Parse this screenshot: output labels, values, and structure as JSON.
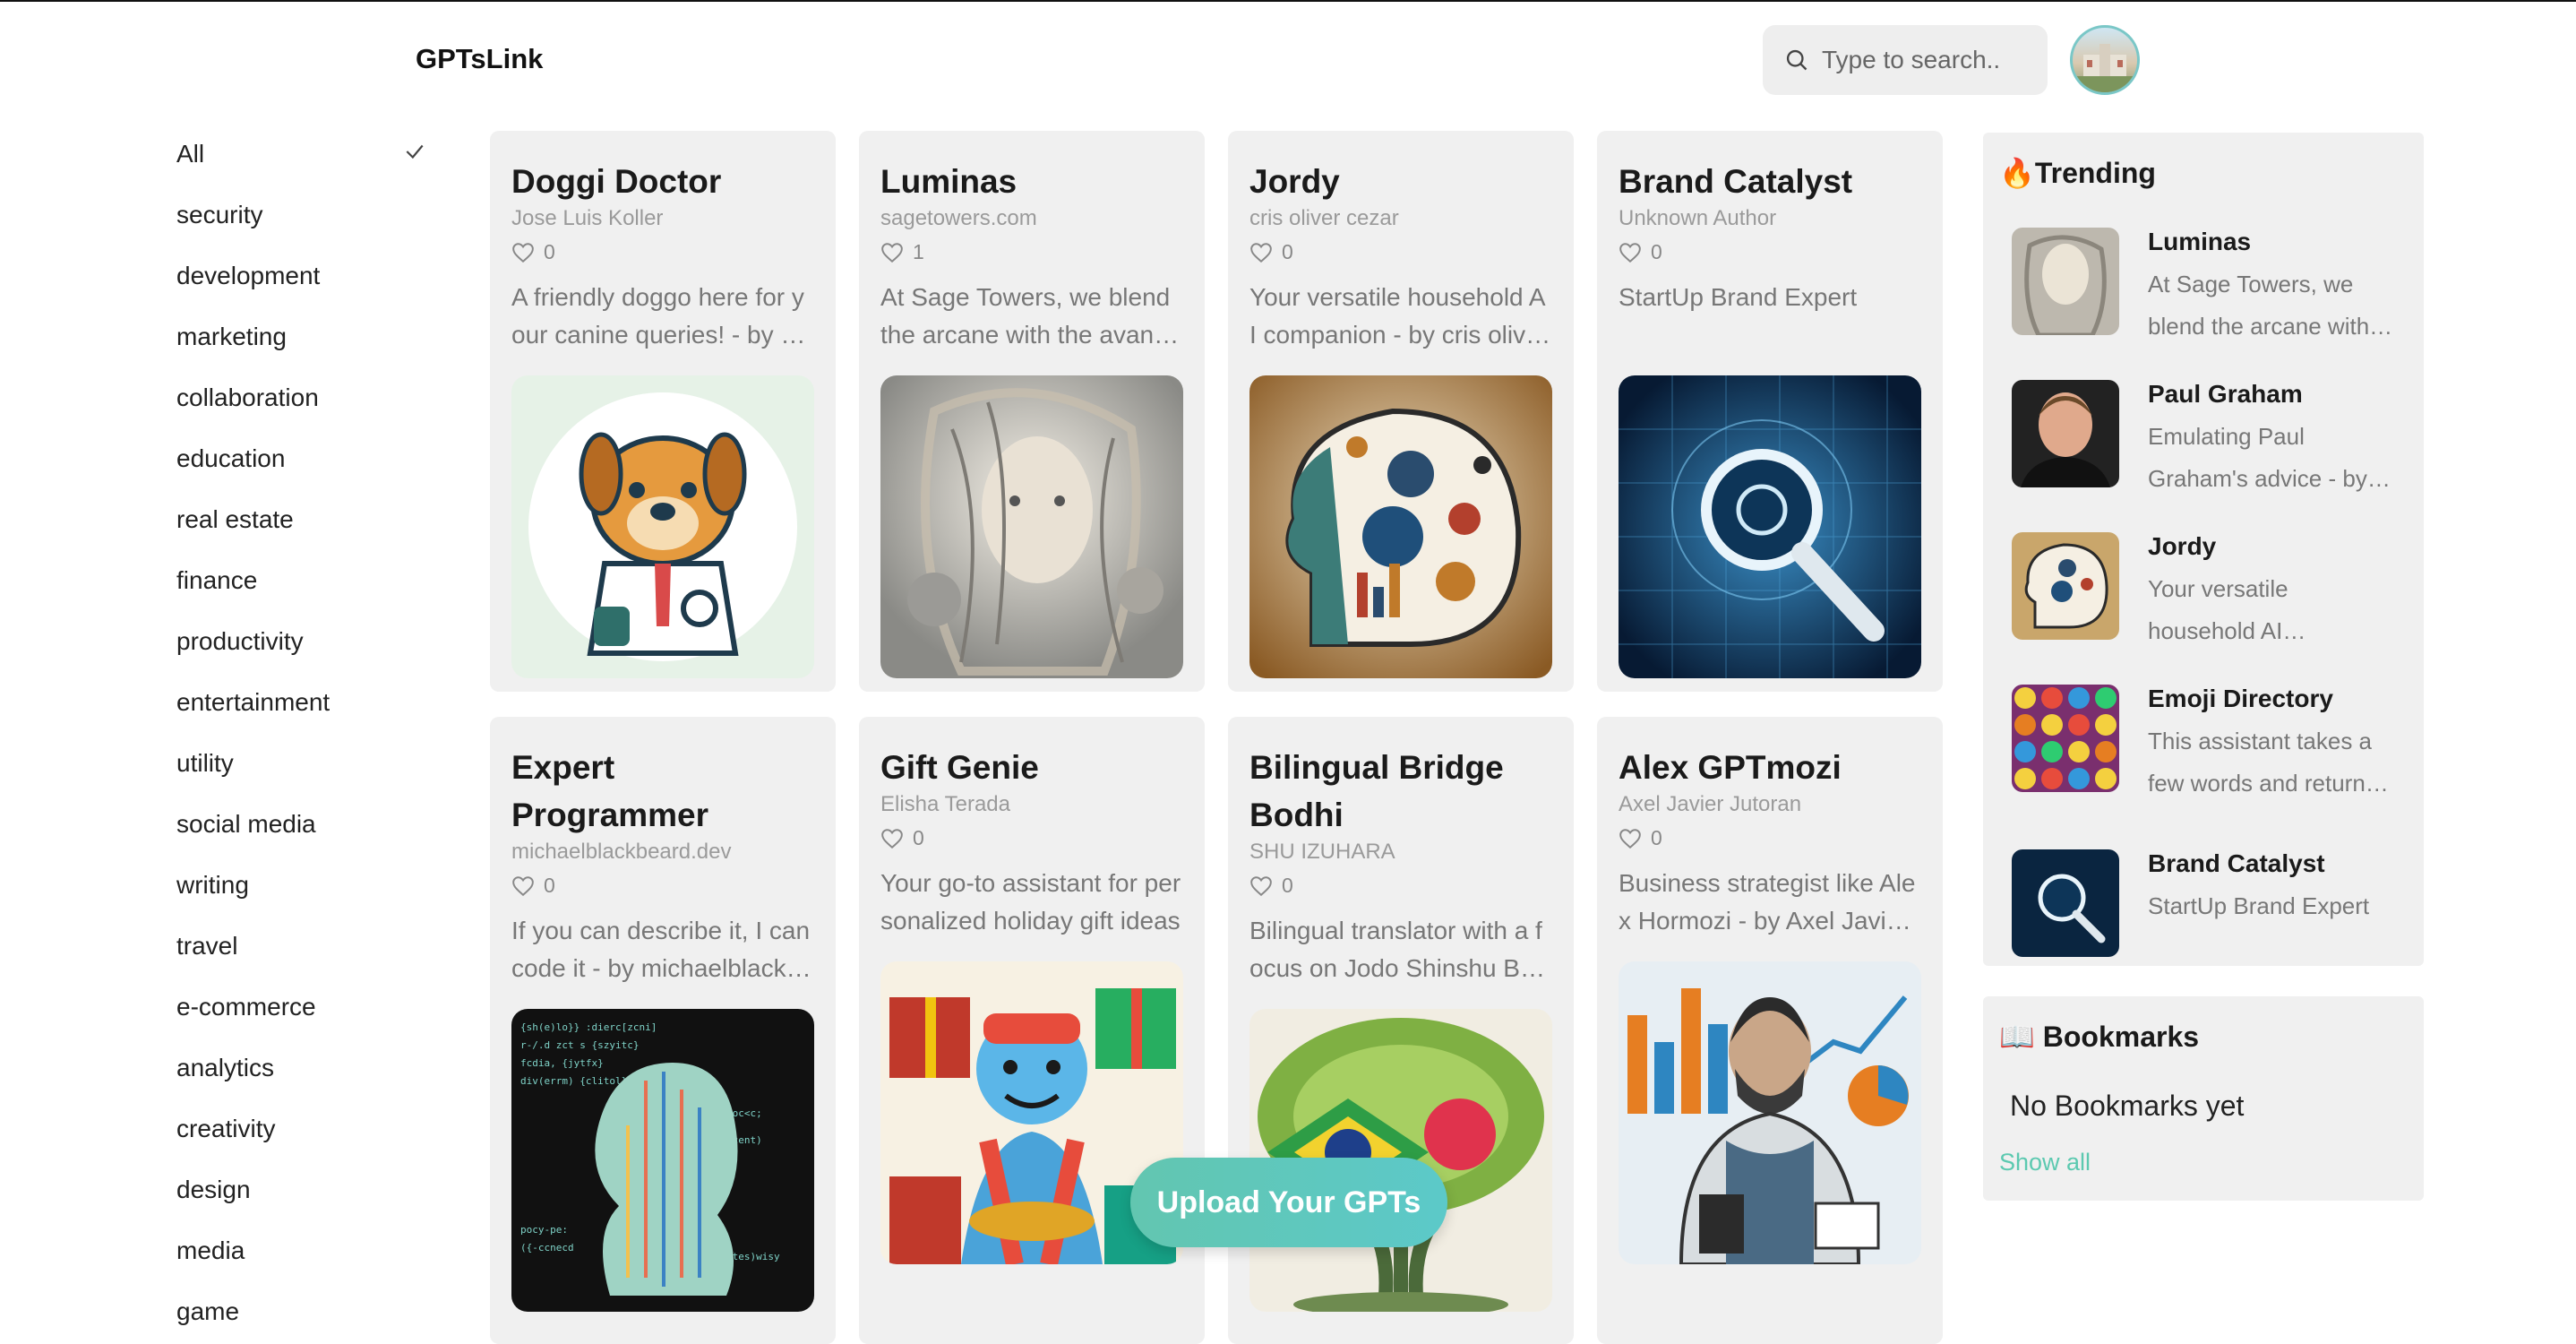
{
  "brand": "GPTsLink",
  "search": {
    "placeholder": "Type to search.."
  },
  "categories": [
    "All",
    "security",
    "development",
    "marketing",
    "collaboration",
    "education",
    "real estate",
    "finance",
    "productivity",
    "entertainment",
    "utility",
    "social media",
    "writing",
    "travel",
    "e-commerce",
    "analytics",
    "creativity",
    "design",
    "media",
    "game"
  ],
  "selected_category": "All",
  "cards": [
    {
      "title": "Doggi Doctor",
      "author": "Jose Luis Koller",
      "likes": "0",
      "desc": "A friendly doggo here for your canine queries! - by Jose Luis Koller"
    },
    {
      "title": "Luminas",
      "author": "sagetowers.com",
      "likes": "1",
      "desc": "At Sage Towers, we blend the arcane with the avant-garde"
    },
    {
      "title": "Jordy",
      "author": "cris oliver cezar",
      "likes": "0",
      "desc": "Your versatile household AI companion - by cris oliver cezar"
    },
    {
      "title": "Brand Catalyst",
      "author": "Unknown Author",
      "likes": "0",
      "desc": "StartUp Brand Expert"
    },
    {
      "title": "Expert Programmer",
      "author": "michaelblackbeard.dev",
      "likes": "0",
      "desc": "If you can describe it, I can code it - by michaelblackbeard.dev"
    },
    {
      "title": "Gift Genie",
      "author": "Elisha Terada",
      "likes": "0",
      "desc": "Your go-to assistant for personalized holiday gift ideas"
    },
    {
      "title": "Bilingual Bridge Bodhi",
      "author": "SHU IZUHARA",
      "likes": "0",
      "desc": "Bilingual translator with a focus on Jodo Shinshu Buddhism"
    },
    {
      "title": "Alex GPTmozi",
      "author": "Axel Javier Jutoran",
      "likes": "0",
      "desc": "Business strategist like Alex Hormozi - by Axel Javier Jutoran"
    }
  ],
  "trending": {
    "title": "🔥Trending",
    "items": [
      {
        "name": "Luminas",
        "desc": "At Sage Towers, we blend the arcane with the avant-garde"
      },
      {
        "name": "Paul Graham",
        "desc": "Emulating Paul Graham's advice - by Paul Graham"
      },
      {
        "name": "Jordy",
        "desc": "Your versatile household AI companion"
      },
      {
        "name": "Emoji Directory",
        "desc": "This assistant takes a few words and returns emojis"
      },
      {
        "name": "Brand Catalyst",
        "desc": "StartUp Brand Expert"
      }
    ]
  },
  "bookmarks": {
    "title": "📖 Bookmarks",
    "empty": "No Bookmarks yet",
    "show_all": "Show all"
  },
  "upload_label": "Upload Your GPTs",
  "colors": {
    "accent": "#5cc9b0",
    "card_bg": "#f0f0f0"
  }
}
